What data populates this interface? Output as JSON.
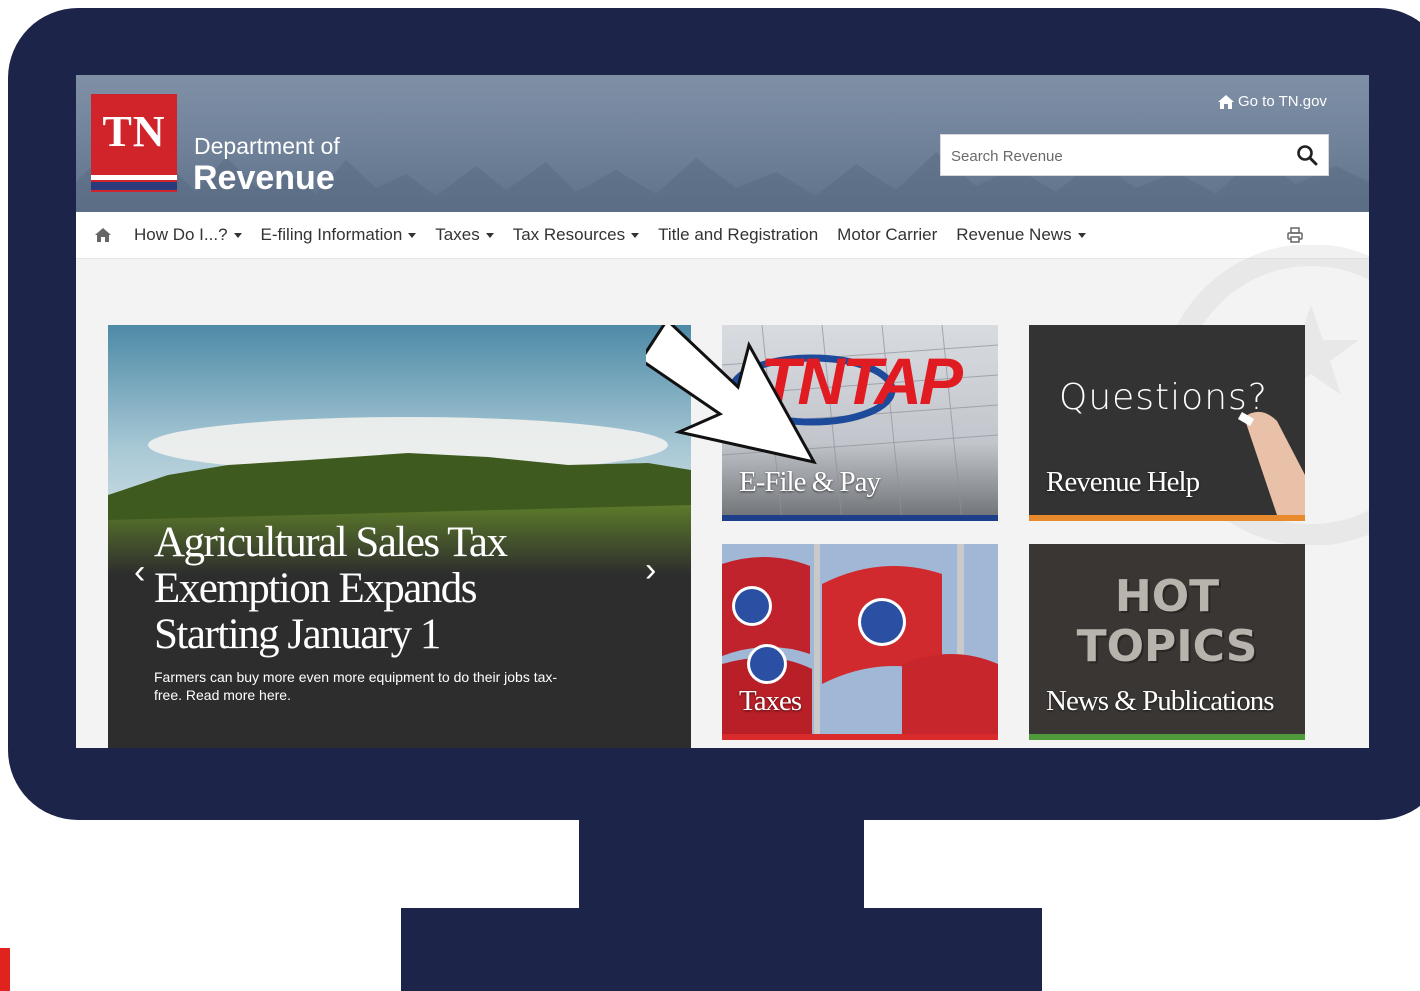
{
  "site": {
    "logo_text": "TN",
    "dept_line1": "Department of",
    "dept_line2": "Revenue",
    "goto_link": "Go to TN.gov",
    "search_placeholder": "Search Revenue"
  },
  "nav": {
    "items": [
      {
        "label": "How Do I...?",
        "dropdown": true
      },
      {
        "label": "E-filing Information",
        "dropdown": true
      },
      {
        "label": "Taxes",
        "dropdown": true
      },
      {
        "label": "Tax Resources",
        "dropdown": true
      },
      {
        "label": "Title and Registration",
        "dropdown": false
      },
      {
        "label": "Motor Carrier",
        "dropdown": false
      },
      {
        "label": "Revenue News",
        "dropdown": true
      }
    ]
  },
  "hero": {
    "title": "Agricultural Sales Tax Exemption Expands Starting January 1",
    "subtitle": "Farmers can buy more even more equipment to do their jobs tax-free. Read more here.",
    "prev": "‹",
    "next": "›"
  },
  "tiles": [
    {
      "label": "E-File & Pay",
      "art_text": "TNTAP",
      "bar_color": "#1d3f8a"
    },
    {
      "label": "Revenue Help",
      "art_text": "Questions?",
      "bar_color": "#e8892b"
    },
    {
      "label": "Taxes",
      "art_text": "",
      "bar_color": "#d92b2b"
    },
    {
      "label": "News & Publications",
      "art_text_line1": "HOT",
      "art_text_line2": "TOPICS",
      "bar_color": "#4f9a3b"
    }
  ],
  "colors": {
    "monitor": "#1d2449",
    "brand_red": "#d0232a",
    "header_bg": "#6f8199"
  }
}
